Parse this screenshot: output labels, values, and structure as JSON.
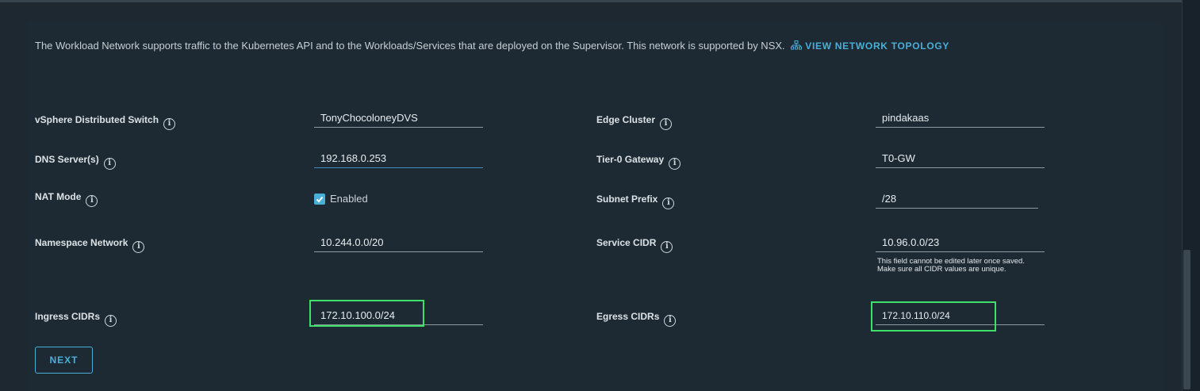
{
  "intro": {
    "text": "The Workload Network supports traffic to the Kubernetes API and to the Workloads/Services that are deployed on the Supervisor. This network is supported by NSX.",
    "link_label": "VIEW NETWORK TOPOLOGY"
  },
  "left": {
    "vds": {
      "label": "vSphere Distributed Switch",
      "value": "TonyChocoloneyDVS"
    },
    "dns": {
      "label": "DNS Server(s)",
      "value": "192.168.0.253"
    },
    "nat": {
      "label": "NAT Mode",
      "checkbox_label": "Enabled",
      "checked": true
    },
    "namespace": {
      "label": "Namespace Network",
      "value": "10.244.0.0/20"
    },
    "ingress": {
      "label": "Ingress CIDRs",
      "value": "172.10.100.0/24"
    }
  },
  "right": {
    "edge": {
      "label": "Edge Cluster",
      "value": "pindakaas"
    },
    "tier0": {
      "label": "Tier-0 Gateway",
      "value": "T0-GW"
    },
    "subnet": {
      "label": "Subnet Prefix",
      "value": "/28"
    },
    "service": {
      "label": "Service CIDR",
      "value": "10.96.0.0/23",
      "helper": "This field cannot be edited later once saved. Make sure all CIDR values are unique."
    },
    "egress": {
      "label": "Egress CIDRs",
      "value": "172.10.110.0/24"
    }
  },
  "info_icon_glyph": "i",
  "next_label": "NEXT",
  "colors": {
    "accent": "#49afd9",
    "highlight": "#3ee06a",
    "background": "#1d2831"
  },
  "icons": [
    "topology-icon",
    "info-icon",
    "checkmark-icon"
  ]
}
